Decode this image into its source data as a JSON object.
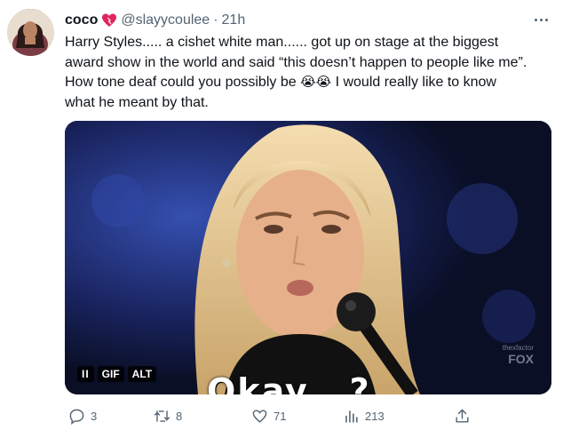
{
  "user": {
    "name": "coco",
    "handle": "@slayycoulee",
    "separator": "·",
    "time": "21h"
  },
  "tweet": {
    "text_line1": "Harry Styles..... a cishet white man...... got up on stage at the biggest",
    "text_line2": "award show in the world and said “this doesn’t happen to people like me”.",
    "text_line3_pre": "How tone deaf could you possibly be ",
    "text_line3_emoji": "😭😭",
    "text_line3_post": " I would really like to know",
    "text_line4": "what he meant by that."
  },
  "media": {
    "badges": [
      "II",
      "GIF",
      "ALT"
    ],
    "caption": "Okay...?",
    "watermark": "FOX",
    "watermark_small": "thexfactor"
  },
  "actions": {
    "replies": "3",
    "retweets": "8",
    "likes": "71",
    "views": "213"
  },
  "colors": {
    "text": "#0f1419",
    "muted": "#536471",
    "heart": "#e0245e",
    "media_bg": "#16204f"
  }
}
